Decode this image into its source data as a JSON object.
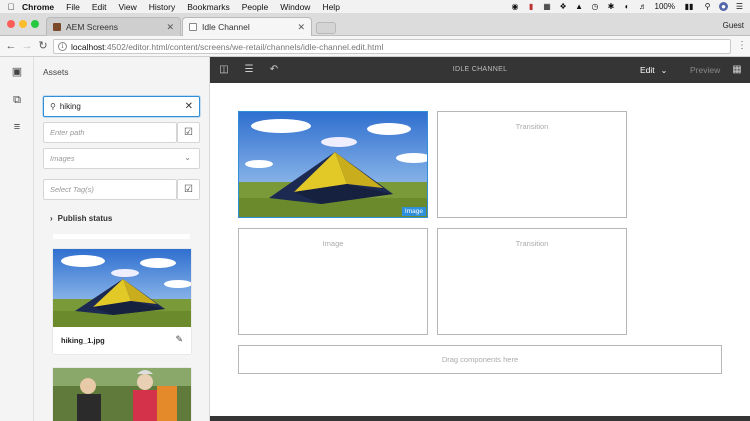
{
  "menubar": {
    "apple_icon": "apple-logo",
    "app_name": "Chrome",
    "items": [
      "File",
      "Edit",
      "View",
      "History",
      "Bookmarks",
      "People",
      "Window",
      "Help"
    ],
    "battery": "100%",
    "status_icons": [
      "record-icon",
      "shield-icon",
      "grid-icon",
      "dropbox-icon",
      "shield-b-icon",
      "clock-icon",
      "bluetooth-icon",
      "wifi-icon",
      "volume-icon",
      "battery-icon",
      "search-icon",
      "user-icon",
      "list-icon"
    ]
  },
  "browser": {
    "tabs": [
      {
        "title": "AEM Screens",
        "active": false
      },
      {
        "title": "Idle Channel",
        "active": true
      }
    ],
    "profile": "Guest",
    "url_host": "localhost",
    "url_rest": ":4502/editor.html/content/screens/we-retail/channels/idle-channel.edit.html"
  },
  "panel": {
    "title": "Assets",
    "search_value": "hiking",
    "path_placeholder": "Enter path",
    "type_value": "Images",
    "tags_placeholder": "Select Tag(s)",
    "publish_status": "Publish status",
    "assets": [
      {
        "name": "hiking_1.jpg"
      },
      {
        "name": ""
      }
    ]
  },
  "editor": {
    "channel_title": "IDLE CHANNEL",
    "mode": "Edit",
    "preview": "Preview",
    "cells": [
      {
        "label": "",
        "badge": "Image"
      },
      {
        "label": "Transition"
      },
      {
        "label": "Image"
      },
      {
        "label": "Transition"
      }
    ],
    "drag_hint": "Drag components here"
  },
  "colors": {
    "accent": "#2f8fd8",
    "toolbar_bg": "#353535",
    "panel_bg": "#f4f4f4"
  }
}
